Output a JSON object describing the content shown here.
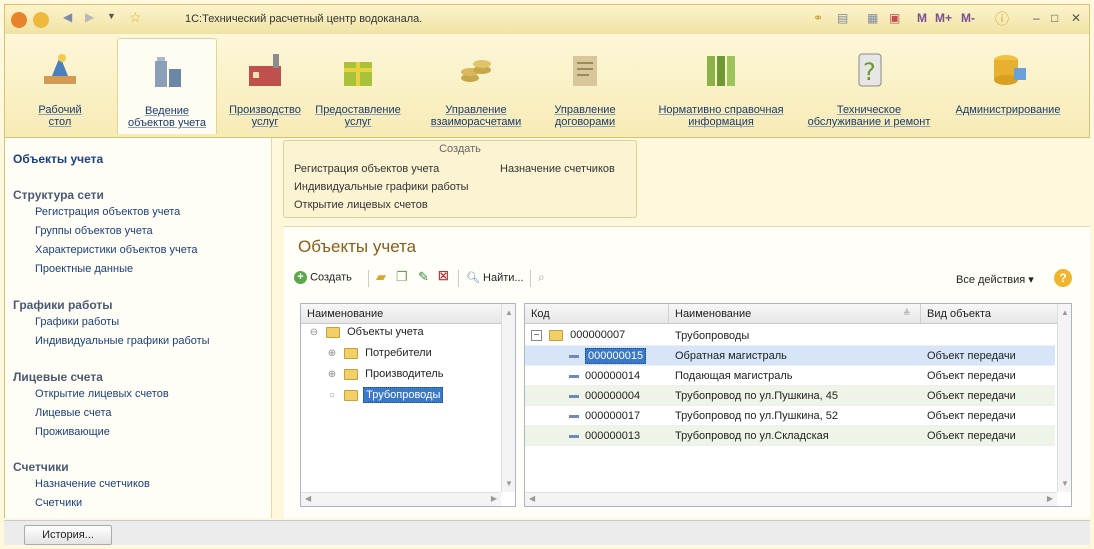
{
  "window": {
    "title": "1С:Технический расчетный центр водоканала.",
    "right_controls": [
      "M",
      "M+",
      "M-"
    ]
  },
  "sections": [
    {
      "label_line1": "Рабочий",
      "label_line2": "стол"
    },
    {
      "label_line1": "Ведение",
      "label_line2": "объектов учета"
    },
    {
      "label_line1": "Производство",
      "label_line2": "услуг"
    },
    {
      "label_line1": "Предоставление",
      "label_line2": "услуг"
    },
    {
      "label_line1": "Управление",
      "label_line2": "взаиморасчетами"
    },
    {
      "label_line1": "Управление",
      "label_line2": "договорами"
    },
    {
      "label_line1": "Нормативно справочная",
      "label_line2": "информация"
    },
    {
      "label_line1": "Техническое",
      "label_line2": "обслуживание и ремонт"
    },
    {
      "label_line1": "Администрирование",
      "label_line2": ""
    }
  ],
  "nav": {
    "title": "Объекты учета",
    "groups": [
      {
        "header": "Структура сети",
        "items": [
          "Регистрация объектов учета",
          "Группы объектов учета",
          "Характеристики объектов учета",
          "Проектные данные"
        ]
      },
      {
        "header": "Графики работы",
        "items": [
          "Графики работы",
          "Индивидуальные графики работы"
        ]
      },
      {
        "header": "Лицевые счета",
        "items": [
          "Открытие лицевых счетов",
          "Лицевые счета",
          "Проживающие"
        ]
      },
      {
        "header": "Счетчики",
        "items": [
          "Назначение счетчиков",
          "Счетчики"
        ]
      }
    ]
  },
  "create_panel": {
    "title": "Создать",
    "links": [
      "Регистрация объектов учета",
      "Индивидуальные графики работы",
      "Открытие лицевых счетов",
      "Назначение счетчиков"
    ]
  },
  "main": {
    "title": "Объекты учета",
    "toolbar": {
      "create_label": "Создать",
      "find_label": "Найти..."
    },
    "all_actions_label": "Все действия ▾"
  },
  "tree": {
    "header": "Наименование",
    "rows": [
      {
        "label": "Объекты учета",
        "expander": "⊖"
      },
      {
        "label": "Потребители",
        "expander": "⊕"
      },
      {
        "label": "Производитель",
        "expander": "⊕"
      },
      {
        "label": "Трубопроводы",
        "expander": "○"
      }
    ]
  },
  "list": {
    "columns": [
      "Код",
      "Наименование",
      "Вид объекта"
    ],
    "group_row": {
      "code": "000000007",
      "name": "Трубопроводы"
    },
    "rows": [
      {
        "code": "000000015",
        "name": "Обратная магистраль",
        "kind": "Объект передачи"
      },
      {
        "code": "000000014",
        "name": "Подающая магистраль",
        "kind": "Объект передачи"
      },
      {
        "code": "000000004",
        "name": "Трубопровод по ул.Пушкина, 45",
        "kind": "Объект передачи"
      },
      {
        "code": "000000017",
        "name": "Трубопровод по ул.Пушкина, 52",
        "kind": "Объект передачи"
      },
      {
        "code": "000000013",
        "name": "Трубопровод по ул.Складская",
        "kind": "Объект передачи"
      }
    ]
  },
  "bottom": {
    "history_label": "История..."
  }
}
